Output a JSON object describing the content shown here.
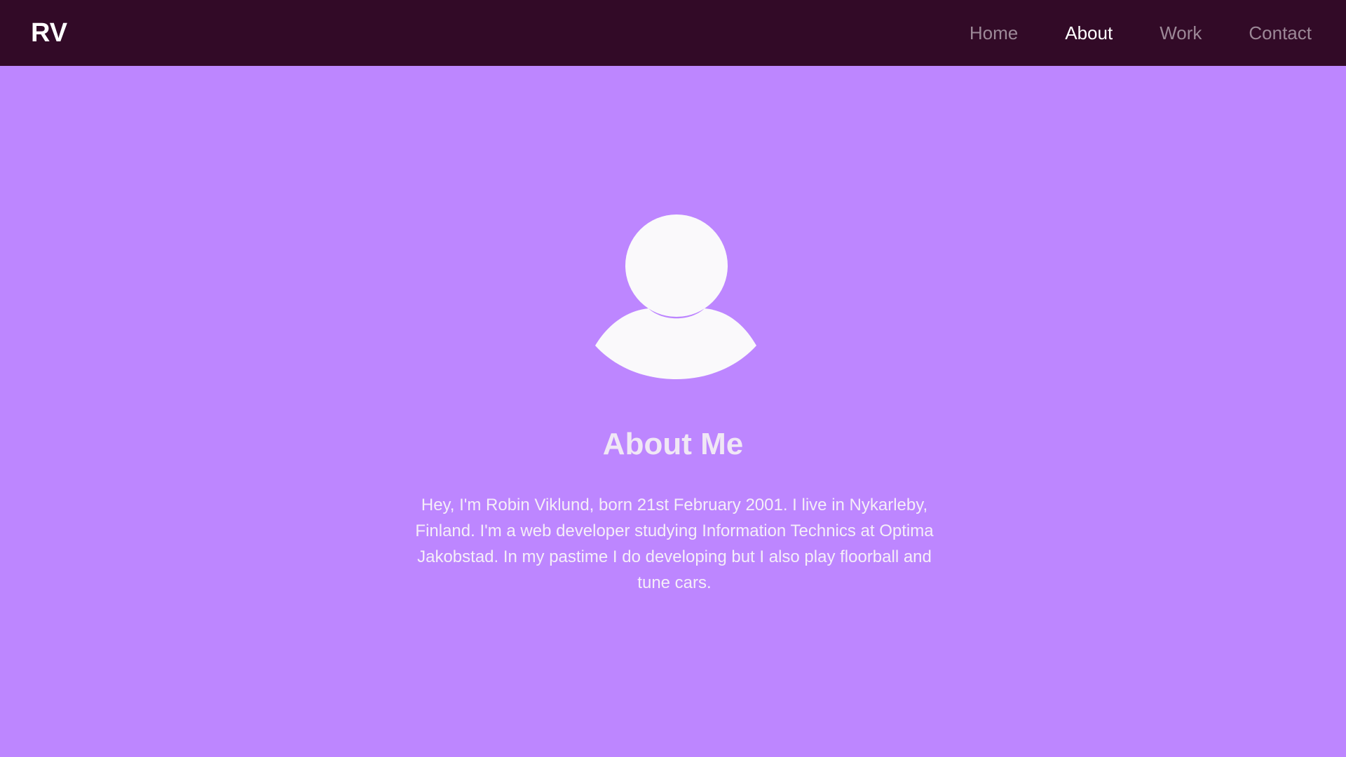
{
  "nav": {
    "brand": "RV",
    "links": [
      {
        "label": "Home",
        "active": false
      },
      {
        "label": "About",
        "active": true
      },
      {
        "label": "Work",
        "active": false
      },
      {
        "label": "Contact",
        "active": false
      }
    ]
  },
  "about": {
    "avatar_icon": "user-avatar-icon",
    "title": "About Me",
    "bio": "Hey, I'm Robin Viklund, born 21st February 2001. I live in Nykarleby, Finland. I'm a web developer studying Information Technics at Optima Jakobstad. In my pastime I do developing but I also play floorball and tune cars."
  },
  "colors": {
    "navbar_bg": "#320a27",
    "page_bg": "#bd86ff",
    "nav_inactive": "#9c8897",
    "nav_active": "#ffffff",
    "avatar": "#faf9fb",
    "text": "#f0e7f5"
  }
}
